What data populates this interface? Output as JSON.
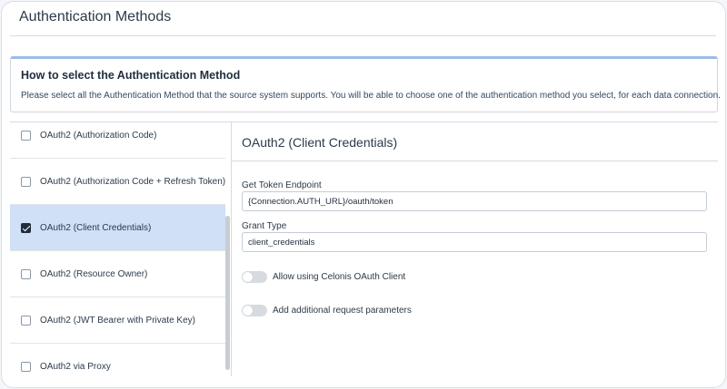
{
  "page": {
    "title": "Authentication Methods"
  },
  "info": {
    "title": "How to select the Authentication Method",
    "text": "Please select all the Authentication Method that the source system supports. You will be able to choose one of the authentication method you select, for each data connection."
  },
  "methods": [
    {
      "label": "OAuth2 (Authorization Code)",
      "checked": false
    },
    {
      "label": "OAuth2 (Authorization Code + Refresh Token)",
      "checked": false
    },
    {
      "label": "OAuth2 (Client Credentials)",
      "checked": true
    },
    {
      "label": "OAuth2 (Resource Owner)",
      "checked": false
    },
    {
      "label": "OAuth2 (JWT Bearer with Private Key)",
      "checked": false
    },
    {
      "label": "OAuth2 via Proxy",
      "checked": false
    }
  ],
  "detail": {
    "title": "OAuth2 (Client Credentials)",
    "token_endpoint": {
      "label": "Get Token Endpoint",
      "value": "{Connection.AUTH_URL}/oauth/token"
    },
    "grant_type": {
      "label": "Grant Type",
      "value": "client_credentials"
    },
    "toggles": [
      {
        "label": "Allow using Celonis OAuth Client",
        "on": false
      },
      {
        "label": "Add additional request parameters",
        "on": false
      }
    ]
  },
  "colors": {
    "selected_row": "#cfe0f7",
    "info_accent": "#9bbce6",
    "checkbox_checked": "#1f2d3d"
  }
}
